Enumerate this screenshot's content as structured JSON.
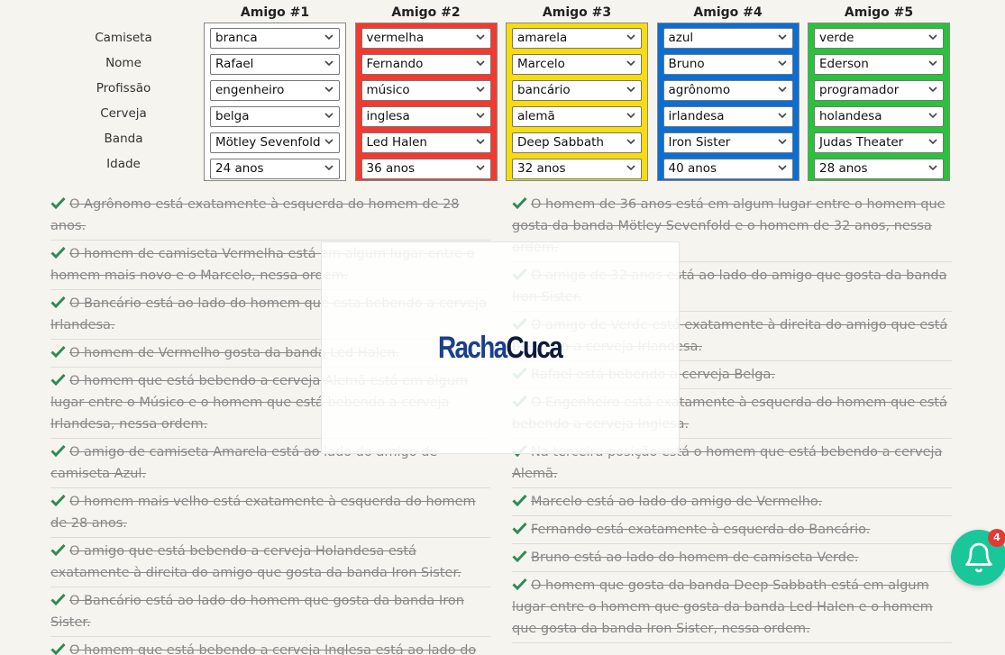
{
  "row_labels": [
    "Camiseta",
    "Nome",
    "Profissão",
    "Cerveja",
    "Banda",
    "Idade"
  ],
  "friends": [
    {
      "title": "Amigo #1",
      "color": "#ffffff",
      "values": [
        "branca",
        "Rafael",
        "engenheiro",
        "belga",
        "Mötley Sevenfold",
        "24 anos"
      ]
    },
    {
      "title": "Amigo #2",
      "color": "#f4392f",
      "values": [
        "vermelha",
        "Fernando",
        "músico",
        "inglesa",
        "Led Halen",
        "36 anos"
      ]
    },
    {
      "title": "Amigo #3",
      "color": "#f7dc0f",
      "values": [
        "amarela",
        "Marcelo",
        "bancário",
        "alemã",
        "Deep Sabbath",
        "32 anos"
      ]
    },
    {
      "title": "Amigo #4",
      "color": "#0a6ed3",
      "values": [
        "azul",
        "Bruno",
        "agrônomo",
        "irlandesa",
        "Iron Sister",
        "40 anos"
      ]
    },
    {
      "title": "Amigo #5",
      "color": "#29c23a",
      "values": [
        "verde",
        "Ederson",
        "programador",
        "holandesa",
        "Judas Theater",
        "28 anos"
      ]
    }
  ],
  "clues_left": [
    "O Agrônomo está exatamente à esquerda do homem de 28 anos.",
    "O homem de camiseta Vermelha está em algum lugar entre o homem mais novo e o Marcelo, nessa ordem.",
    "O Bancário está ao lado do homem que esta bebendo a cerveja Irlandesa.",
    "O homem de Vermelho gosta da banda Led Halen.",
    "O homem que está bebendo a cerveja Alemã está em algum lugar entre o Músico e o homem que está bebendo a cerveja Irlandesa, nessa ordem.",
    "O amigo de camiseta Amarela está ao lado do amigo de camiseta Azul.",
    "O homem mais velho está exatamente à esquerda do homem de 28 anos.",
    "O amigo que está bebendo a cerveja Holandesa está exatamente à direita do amigo que gosta da banda Iron Sister.",
    "O Bancário está ao lado do homem que gosta da banda Iron Sister.",
    "O homem que está bebendo a cerveja Inglesa está ao lado do homem de Amarelo."
  ],
  "clues_right": [
    "O homem de 36 anos está em algum lugar entre o homem que gosta da banda Mötley Sevenfold e o homem de 32 anos, nessa ordem.",
    "O amigo de 32 anos está ao lado do amigo que gosta da banda Iron Sister.",
    "O amigo de Verde está exatamente à direita do amigo que está bebendo a cerveja Irlandesa.",
    "Rafael está bebendo a cerveja Belga.",
    "O Engenheiro está exatamente à esquerda do homem que está bebendo a cerveja Inglesa.",
    "Na terceira posição está o homem que está bebendo a cerveja Alemã.",
    "Marcelo está ao lado do amigo de Vermelho.",
    "Fernando está exatamente à esquerda do Bancário.",
    "Bruno está ao lado do homem de camiseta Verde.",
    "O homem que gosta da banda Deep Sabbath está em algum lugar entre o homem que gosta da banda Led Halen e o homem que gosta da banda Iron Sister, nessa ordem."
  ],
  "logo": {
    "part1": "Racha",
    "part2": "Cuca"
  },
  "notification": {
    "count": "4",
    "icon": "bell-icon"
  },
  "colors": {
    "check": "#2e8b57",
    "accent": "#19c79b"
  }
}
